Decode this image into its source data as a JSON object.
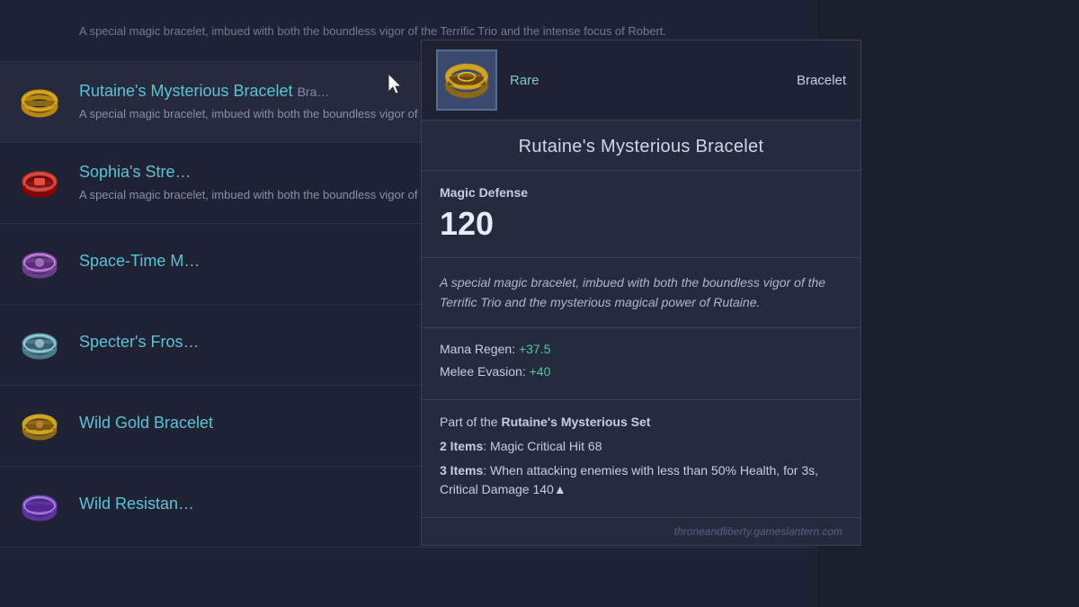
{
  "background": {
    "top_row": {
      "desc": "A special magic bracelet, imbued with both the boundless vigor of the Terrific Trio and the intense focus of Robert."
    }
  },
  "list": {
    "items": [
      {
        "id": "rutaines-bracelet",
        "name": "Rutaine's Mysterious Bracelet",
        "name_truncated": "Rutaine's Mysterious Bracelet",
        "desc": "A special magic bracelet, imbued with both the boundless vigor of the Terrific Trio and the",
        "type": "bracelet",
        "highlighted": true
      },
      {
        "id": "sophias-strength",
        "name": "Sophia's Stre…",
        "name_full": "Sophia's Strength",
        "desc": "A special magic bracelet, imbued with both the boundless vigor of the Terrific Trio and the",
        "type": "bracelet",
        "highlighted": false
      },
      {
        "id": "spacetime-m",
        "name": "Space-Time M…",
        "name_full": "Space-Time Mystical",
        "desc": "",
        "type": "bracelet",
        "highlighted": false
      },
      {
        "id": "specters-frost",
        "name": "Specter's Fros…",
        "name_full": "Specter's Frost",
        "desc": "",
        "type": "bracelet",
        "highlighted": false
      },
      {
        "id": "wild-gold-bra",
        "name": "Wild Gold Bra…",
        "name_full": "Wild Gold Bracelet",
        "desc": "",
        "type": "bracelet",
        "highlighted": false
      },
      {
        "id": "wild-resistant",
        "name": "Wild Resistan…",
        "name_full": "Wild Resistance",
        "desc": "",
        "type": "bracelet",
        "highlighted": false
      }
    ]
  },
  "detail": {
    "rarity": "Rare",
    "type": "Bracelet",
    "title": "Rutaine's Mysterious Bracelet",
    "stat_label": "Magic Defense",
    "stat_value": "120",
    "description": "A special magic bracelet, imbued with both the boundless vigor of the Terrific Trio and the mysterious magical power of Rutaine.",
    "bonuses": [
      {
        "label": "Mana Regen:",
        "value": "+37.5"
      },
      {
        "label": "Melee Evasion:",
        "value": "+40"
      }
    ],
    "set_intro": "Part of the ",
    "set_name": "Rutaine's Mysterious Set",
    "set_items": [
      {
        "count": "2 Items",
        "desc": ": Magic Critical Hit 68"
      },
      {
        "count": "3 Items",
        "desc": ": When attacking enemies with less than 50% Health, for 3s, Critical Damage 140▲"
      }
    ],
    "footer": "throneandliberty.gameslantern.com"
  },
  "icons": {
    "bracelet_gold": "⌀",
    "bracelet_red": "⌀",
    "bracelet_purple": "⌀",
    "bracelet_silver": "⌀",
    "bracelet_wild": "⌀",
    "bracelet_resistant": "⌀"
  }
}
